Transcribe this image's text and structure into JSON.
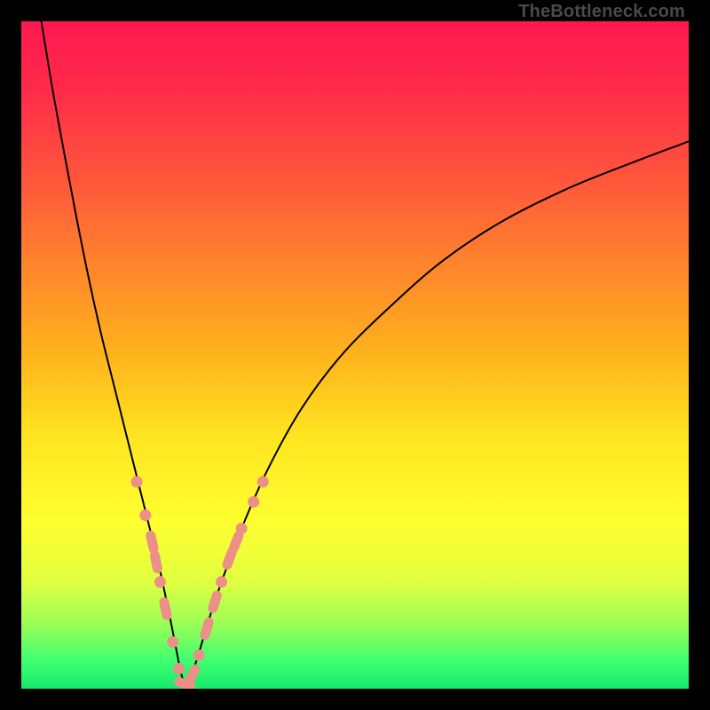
{
  "attribution": "TheBottleneck.com",
  "chart_data": {
    "type": "line",
    "title": "",
    "xlabel": "",
    "ylabel": "",
    "xlim": [
      0,
      100
    ],
    "ylim": [
      0,
      100
    ],
    "grid": false,
    "legend": false,
    "series": [
      {
        "name": "bottleneck-curve",
        "x": [
          3,
          5,
          8,
          10,
          12,
          14,
          16,
          17.5,
          19,
          20.5,
          22,
          23,
          23.8,
          24.5,
          25.3,
          26.5,
          28,
          30,
          33,
          37,
          42,
          48,
          55,
          63,
          72,
          82,
          92,
          100
        ],
        "y": [
          100,
          88,
          72,
          62,
          53,
          45,
          37,
          31,
          25,
          19,
          12,
          7,
          3,
          0.5,
          1.5,
          5,
          10,
          16,
          24,
          33,
          42,
          50,
          57,
          64,
          70,
          75,
          79,
          82
        ]
      }
    ],
    "markers": {
      "name": "highlight-points",
      "color": "#eb8f88",
      "points": [
        {
          "x": 17.3,
          "y": 31
        },
        {
          "x": 18.6,
          "y": 26
        },
        {
          "x": 19.6,
          "y": 22
        },
        {
          "x": 20.2,
          "y": 19
        },
        {
          "x": 20.8,
          "y": 16
        },
        {
          "x": 21.6,
          "y": 12
        },
        {
          "x": 22.7,
          "y": 7
        },
        {
          "x": 23.6,
          "y": 3
        },
        {
          "x": 24.5,
          "y": 0.6
        },
        {
          "x": 25.6,
          "y": 2
        },
        {
          "x": 26.6,
          "y": 5
        },
        {
          "x": 27.8,
          "y": 9
        },
        {
          "x": 29.0,
          "y": 13
        },
        {
          "x": 30.0,
          "y": 16
        },
        {
          "x": 31.2,
          "y": 19.5
        },
        {
          "x": 32.2,
          "y": 22
        },
        {
          "x": 33.0,
          "y": 24
        },
        {
          "x": 34.8,
          "y": 28
        },
        {
          "x": 36.2,
          "y": 31
        }
      ]
    },
    "background_gradient": {
      "top": "#ff1850",
      "mid": "#ffe420",
      "bottom": "#17e86b"
    }
  }
}
